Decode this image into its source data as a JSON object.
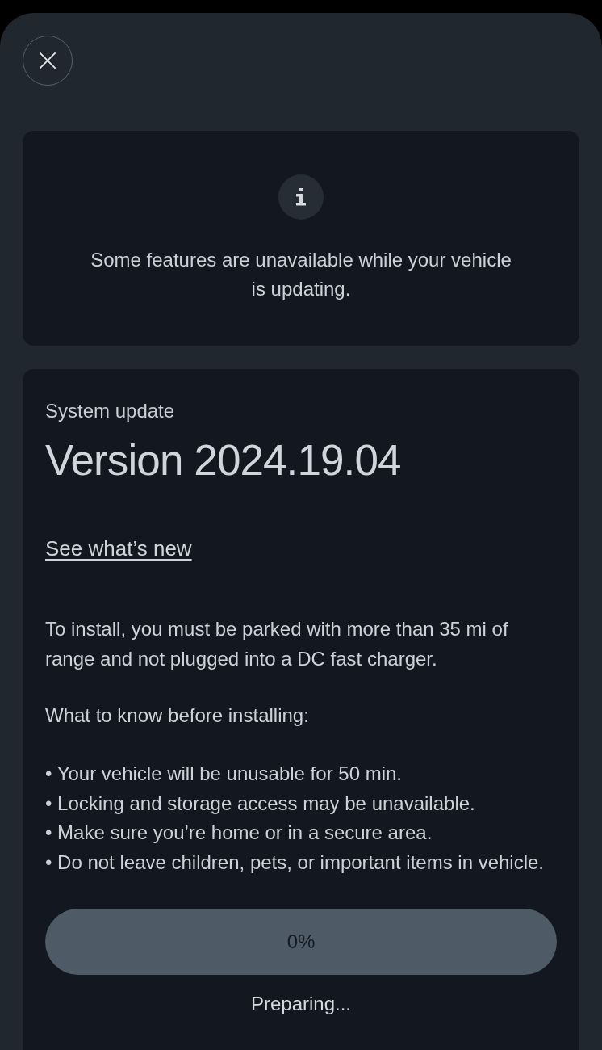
{
  "notice": {
    "message": "Some features are unavailable while your vehicle is updating."
  },
  "update": {
    "label": "System update",
    "version": "Version 2024.19.04",
    "link": "See what’s new",
    "requirement": "To install, you must be parked with more than 35 mi of range and not plugged into a DC fast charger.",
    "checklist_title": "What to know before installing:",
    "checklist": [
      "• Your vehicle will be unusable for 50 min.",
      "• Locking and storage access may be unavailable.",
      "• Make sure you’re home or in a secure area.",
      "• Do not leave children, pets, or important items in vehicle."
    ],
    "progress": {
      "level": 0,
      "reading": "0%"
    },
    "status": "Preparing..."
  }
}
